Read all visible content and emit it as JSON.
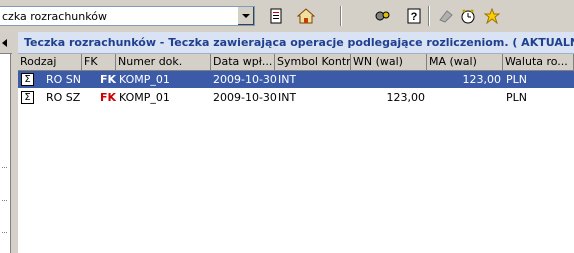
{
  "toolbar": {
    "combo_value": "czka rozrachunków",
    "icons": [
      "document-edit-icon",
      "home-icon",
      "tools-icon",
      "help-icon",
      "eraser-icon",
      "clock-icon",
      "star-icon"
    ]
  },
  "panel": {
    "title": "Teczka rozrachunków - Teczka zawierająca operacje podlegające rozliczeniom. ( AKTUALNE )"
  },
  "table": {
    "columns": [
      "Rodzaj",
      "FK",
      "Numer dok.",
      "Data wpł...",
      "Symbol Kontr.",
      "WN (wal)",
      "MA (wal)",
      "Waluta ro..."
    ],
    "rows": [
      {
        "rodzaj": "RO SN",
        "fk": "FK",
        "numer": "KOMP_01",
        "data": "2009-10-30",
        "symbol": "INT",
        "wn": "",
        "ma": "123,00",
        "waluta": "PLN",
        "selected": true
      },
      {
        "rodzaj": "RO SZ",
        "fk": "FK",
        "numer": "KOMP_01",
        "data": "2009-10-30",
        "symbol": "INT",
        "wn": "123,00",
        "ma": "",
        "waluta": "PLN",
        "selected": false
      }
    ]
  },
  "colors": {
    "selection": "#3b5ba8",
    "title_text": "#1f3f8f",
    "fk": "#cc0000"
  }
}
